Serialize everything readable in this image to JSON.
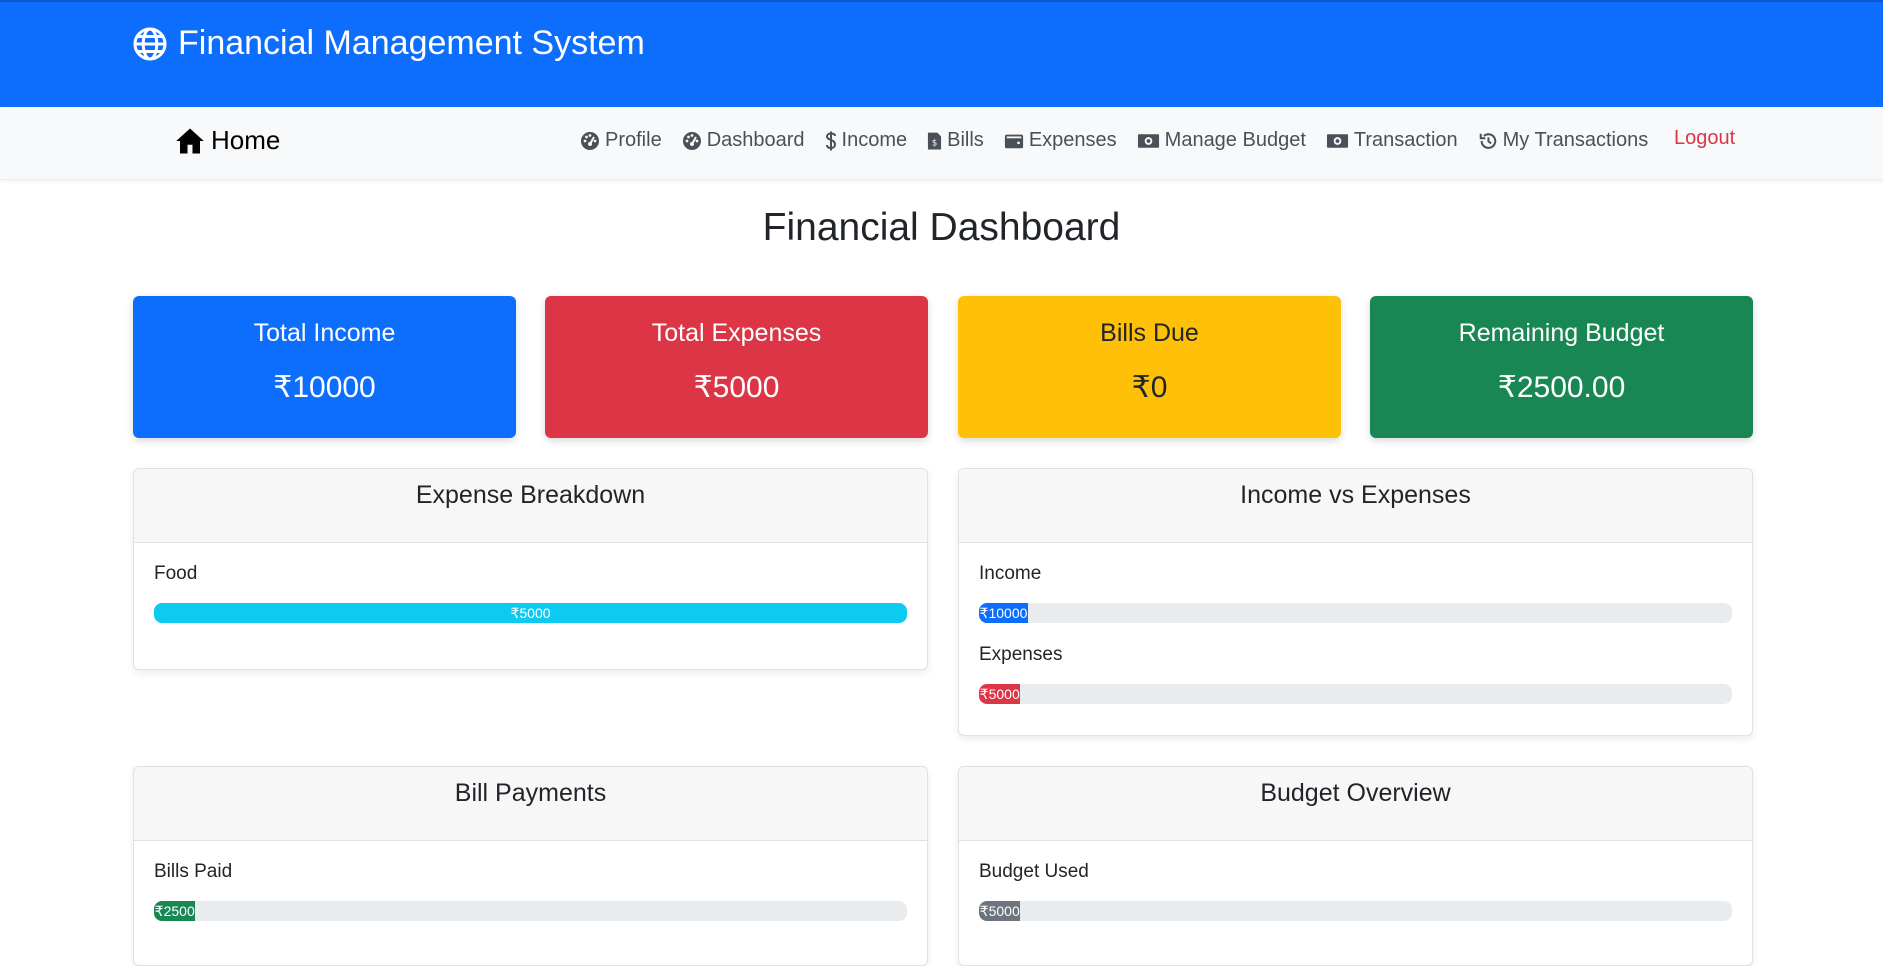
{
  "app": {
    "title": "Financial Management System"
  },
  "nav": {
    "home": "Home",
    "items": [
      {
        "label": "Profile",
        "icon": "dashboard-gauge-icon"
      },
      {
        "label": "Dashboard",
        "icon": "dashboard-gauge-icon"
      },
      {
        "label": "Income",
        "icon": "dollar-icon"
      },
      {
        "label": "Bills",
        "icon": "bill-icon"
      },
      {
        "label": "Expenses",
        "icon": "wallet-icon"
      },
      {
        "label": "Manage Budget",
        "icon": "money-bill-icon"
      },
      {
        "label": "Transaction",
        "icon": "money-bill-icon"
      },
      {
        "label": "My Transactions",
        "icon": "history-icon"
      }
    ],
    "logout": "Logout"
  },
  "page": {
    "title": "Financial Dashboard"
  },
  "stats": [
    {
      "label": "Total Income",
      "value": "₹10000",
      "color": "#0d6efd"
    },
    {
      "label": "Total Expenses",
      "value": "₹5000",
      "color": "#dc3545"
    },
    {
      "label": "Bills Due",
      "value": "₹0",
      "color": "#ffc107"
    },
    {
      "label": "Remaining Budget",
      "value": "₹2500.00",
      "color": "#198754"
    }
  ],
  "panels": {
    "expense_breakdown": {
      "title": "Expense Breakdown",
      "rows": [
        {
          "label": "Food",
          "bar_text": "₹5000",
          "percent": 100,
          "color": "#0dcaf0"
        }
      ]
    },
    "income_vs_expenses": {
      "title": "Income vs Expenses",
      "rows": [
        {
          "label": "Income",
          "bar_text": "₹10000",
          "percent": 6.5,
          "color": "#0d6efd"
        },
        {
          "label": "Expenses",
          "bar_text": "₹5000",
          "percent": 5.5,
          "color": "#dc3545"
        }
      ]
    },
    "bill_payments": {
      "title": "Bill Payments",
      "rows": [
        {
          "label": "Bills Paid",
          "bar_text": "₹2500",
          "percent": 5.5,
          "color": "#198754"
        }
      ]
    },
    "budget_overview": {
      "title": "Budget Overview",
      "rows": [
        {
          "label": "Budget Used",
          "bar_text": "₹5000",
          "percent": 5.5,
          "color": "#6c757d"
        }
      ]
    }
  }
}
